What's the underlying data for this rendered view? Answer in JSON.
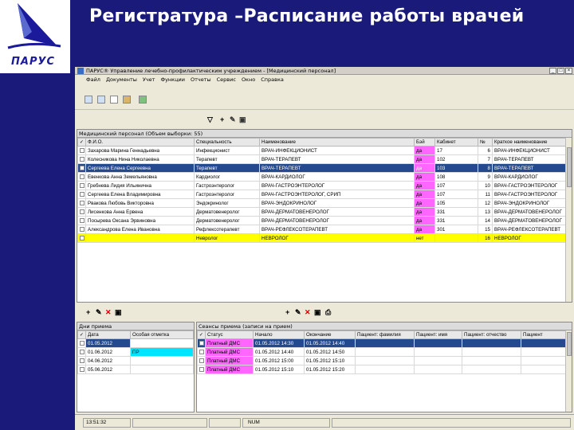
{
  "slide": {
    "title": "Регистратура –Расписание работы врачей",
    "logo_text": "ПАРУС"
  },
  "window": {
    "title": "ПАРУС® Управление лечебно-профилактическим учреждением - [Медицинский персонал]"
  },
  "menu": [
    "Файл",
    "Документы",
    "Учет",
    "Функции",
    "Отчеты",
    "Сервис",
    "Окно",
    "Справка"
  ],
  "main": {
    "caption": "Медицинский персонал (Объем выборки: 55)",
    "columns": [
      "✓",
      "Ф.И.О.",
      "Специальность",
      "Наименование",
      "Бэй",
      "Кабинет",
      "№",
      "Краткое наименование"
    ],
    "rows": [
      [
        "",
        "Захарова Марина Геннадьевна",
        "Инфекционист",
        "ВРАЧ-ИНФЕКЦИОНИСТ",
        "да",
        "17",
        "6",
        "ВРАЧ-ИНФЕКЦИОНИСТ"
      ],
      [
        "",
        "Колесникова Нина Николаевна",
        "Терапевт",
        "ВРАЧ-ТЕРАПЕВТ",
        "да",
        "102",
        "7",
        "ВРАЧ-ТЕРАПЕВТ"
      ],
      [
        "",
        "Сергеева Елена Сергеевна",
        "Терапевт",
        "ВРАЧ-ТЕРАПЕВТ",
        "да",
        "103",
        "8",
        "ВРАЧ-ТЕРАПЕВТ"
      ],
      [
        "",
        "Евенкова Анна Земельяновна",
        "Кардиолог",
        "ВРАЧ-КАРДИОЛОГ",
        "да",
        "108",
        "9",
        "ВРАЧ-КАРДИОЛОГ"
      ],
      [
        "",
        "Гребнева Лидия Ильинична",
        "Гастроэнтеролог",
        "ВРАЧ-ГАСТРОЭНТЕРОЛОГ",
        "да",
        "107",
        "10",
        "ВРАЧ-ГАСТРОЭНТЕРОЛОГ"
      ],
      [
        "",
        "Сергеева Елена Владимировна",
        "Гастроэнтеролог",
        "ВРАЧ-ГАСТРОЭНТЕРОЛОГ, СРИП",
        "да",
        "107",
        "11",
        "ВРАЧ-ГАСТРОЭНТЕРОЛОГ"
      ],
      [
        "",
        "Рвакова Любовь Викторовна",
        "Эндокринолог",
        "ВРАЧ-ЭНДОКРИНОЛОГ",
        "да",
        "105",
        "12",
        "ВРАЧ-ЭНДОКРИНОЛОГ"
      ],
      [
        "",
        "Лисенкова Анна Ервена",
        "Дерматовенеролог",
        "ВРАЧ-ДЕРМАТОВЕНЕРОЛОГ",
        "да",
        "331",
        "13",
        "ВРАЧ-ДЕРМАТОВЕНЕРОЛОГ"
      ],
      [
        "",
        "Посырева Оксана Эрвиновна",
        "Дерматовенеролог",
        "ВРАЧ-ДЕРМАТОВЕНЕРОЛОГ",
        "да",
        "331",
        "14",
        "ВРАЧ-ДЕРМАТОВЕНЕРОЛОГ"
      ],
      [
        "",
        "Александрова Елена Ивановна",
        "Рефлексотерапевт",
        "ВРАЧ-РЕФЛЕКСОТЕРАПЕВТ",
        "да",
        "301",
        "15",
        "ВРАЧ-РЕФЛЕКСОТЕРАПЕВТ"
      ],
      [
        "",
        "",
        "Невролог",
        "НЕВРОЛОГ",
        "нет",
        "",
        "16",
        "НЕВРОЛОГ"
      ]
    ]
  },
  "days": {
    "caption": "Дни приема",
    "columns": [
      "✓",
      "Дата",
      "Особая отметка"
    ],
    "rows": [
      [
        "",
        "01.05.2012",
        ""
      ],
      [
        "",
        "01.06.2012",
        "ПР"
      ],
      [
        "",
        "04.06.2012",
        ""
      ],
      [
        "",
        "05.06.2012",
        ""
      ]
    ]
  },
  "sessions": {
    "caption": "Сеансы приема (записи на прием)",
    "columns": [
      "✓",
      "Статус",
      "Начало",
      "Окончание",
      "Пациент: фамилия",
      "Пациент: имя",
      "Пациент: отчество",
      "Пациент"
    ],
    "rows": [
      [
        "",
        "Платный ДМС",
        "01.05.2012 14:30",
        "01.05.2012 14:40",
        "",
        "",
        "",
        ""
      ],
      [
        "",
        "Платный ДМС",
        "01.05.2012 14:40",
        "01.05.2012 14:50",
        "",
        "",
        "",
        ""
      ],
      [
        "",
        "Платный ДМС",
        "01.05.2012 15:00",
        "01.05.2012 15:10",
        "",
        "",
        "",
        ""
      ],
      [
        "",
        "Платный ДМС",
        "01.05.2012 15:10",
        "01.05.2012 15:20",
        "",
        "",
        "",
        ""
      ]
    ]
  },
  "status": {
    "time": "13:51:32",
    "num": "NUM"
  }
}
